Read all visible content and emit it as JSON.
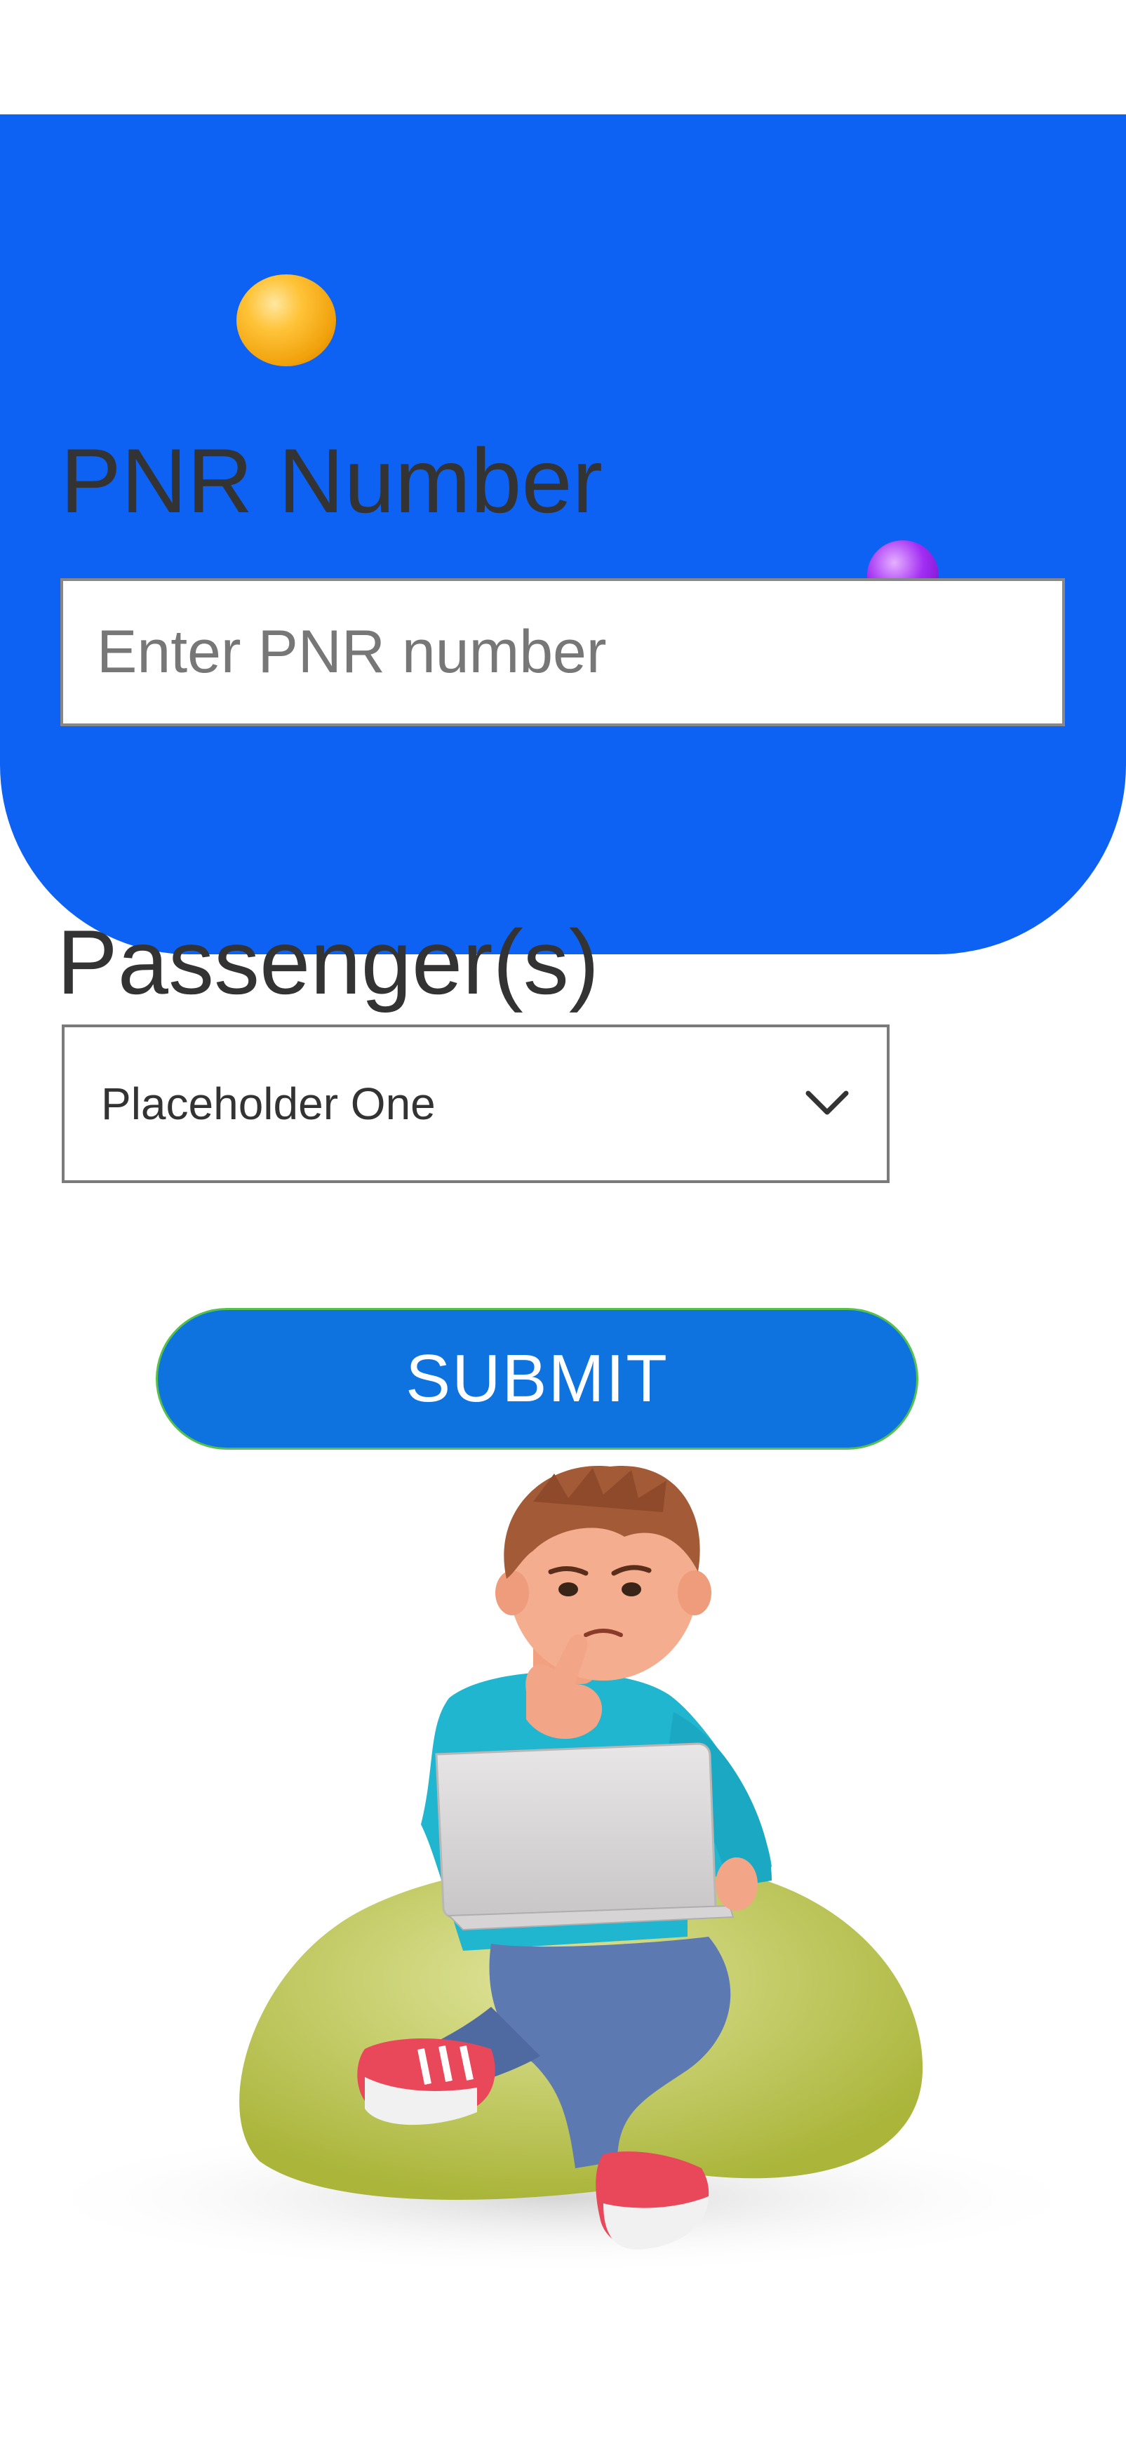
{
  "form": {
    "pnr_label": "PNR Number",
    "pnr_placeholder": "Enter PNR number",
    "pnr_value": "",
    "passengers_label": "Passenger(s)",
    "passengers_selected": "Placeholder One",
    "submit_label": "SUBMIT"
  },
  "icons": {
    "dropdown": "chevron-down-icon",
    "illustration": "boy-on-beanbag-with-laptop"
  },
  "colors": {
    "hero_background": "#0d62f4",
    "submit_background": "#0e73de",
    "submit_border": "#55c04a",
    "label_text": "#333333"
  }
}
